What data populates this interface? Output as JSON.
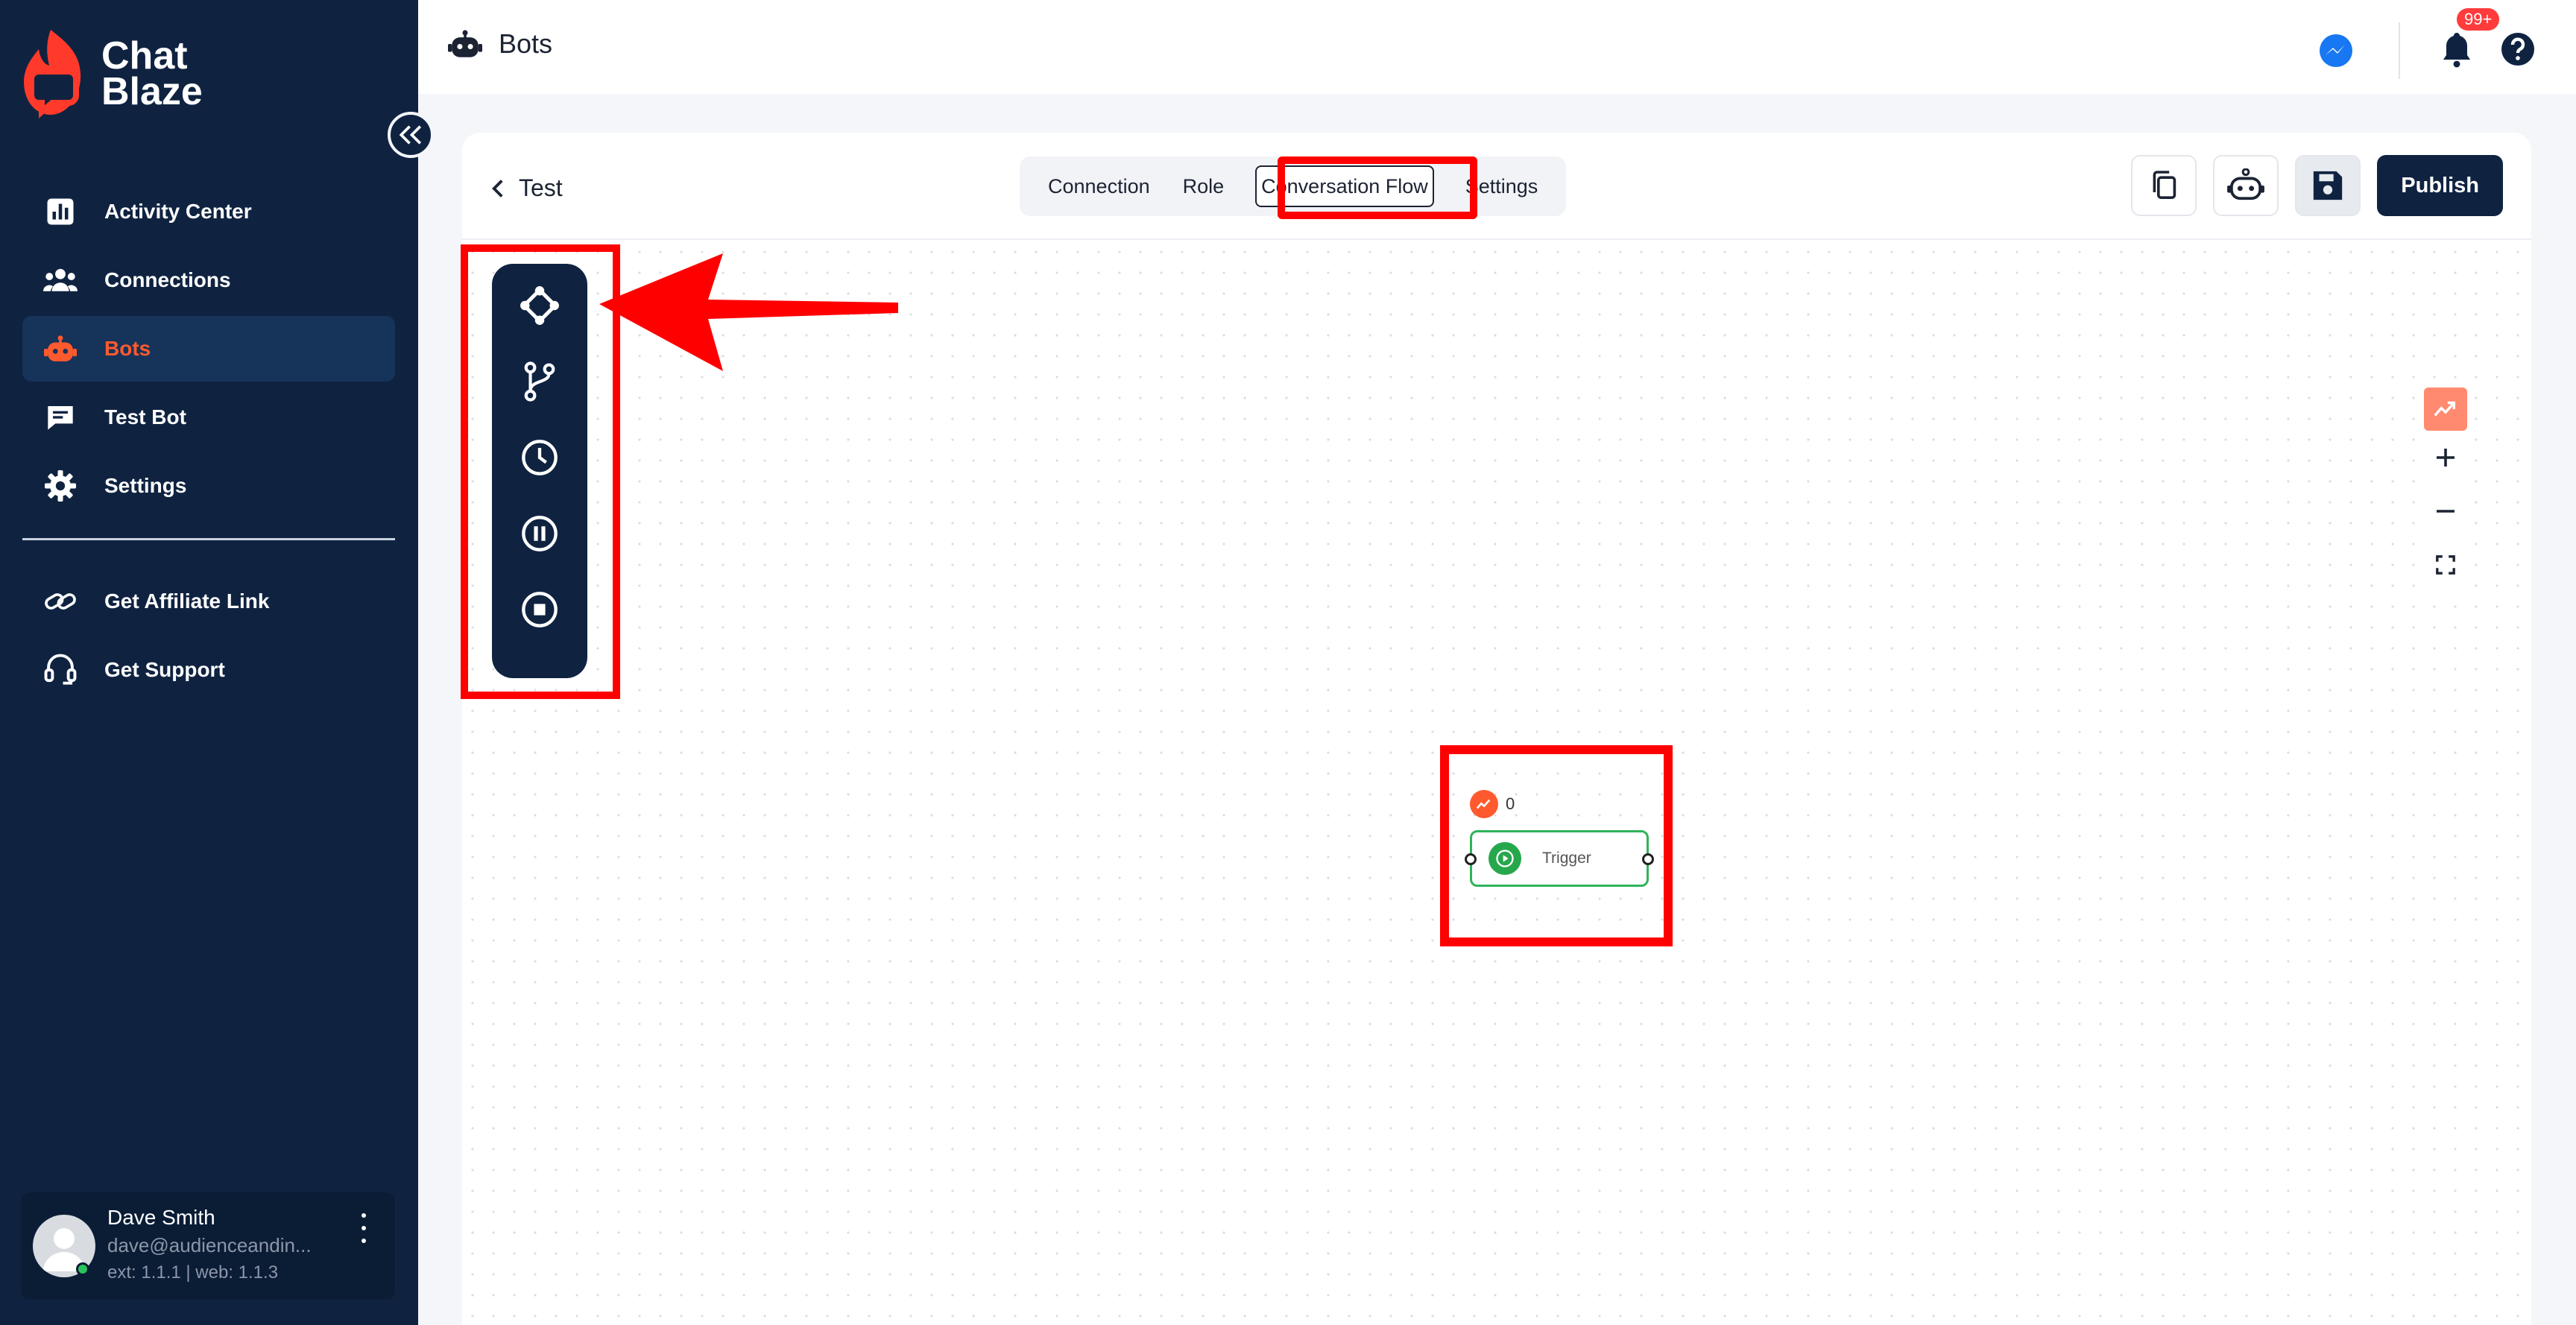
{
  "brand": {
    "line1": "Chat",
    "line2": "Blaze",
    "accent": "#ff5a2e",
    "sidebar_bg": "#0f2341"
  },
  "sidebar": {
    "items": [
      {
        "label": "Activity Center",
        "icon": "bar-chart-icon"
      },
      {
        "label": "Connections",
        "icon": "users-icon"
      },
      {
        "label": "Bots",
        "icon": "robot-icon",
        "active": true
      },
      {
        "label": "Test Bot",
        "icon": "chat-icon"
      },
      {
        "label": "Settings",
        "icon": "gear-icon"
      }
    ],
    "secondary": [
      {
        "label": "Get Affiliate Link",
        "icon": "link-icon"
      },
      {
        "label": "Get Support",
        "icon": "headset-icon"
      }
    ],
    "user": {
      "name": "Dave Smith",
      "email": "dave@audienceandin...",
      "versions": "ext: 1.1.1 | web: 1.1.3"
    }
  },
  "header": {
    "title": "Bots",
    "notification_badge": "99+"
  },
  "bot": {
    "back_label": "Test",
    "tabs": [
      "Connection",
      "Role",
      "Conversation Flow",
      "Settings"
    ],
    "active_tab": "Conversation Flow",
    "publish_label": "Publish"
  },
  "canvas": {
    "palette": [
      "hub-node-icon",
      "branch-icon",
      "clock-icon",
      "pause-icon",
      "stop-icon"
    ],
    "trigger_node": {
      "label": "Trigger",
      "count": "0"
    }
  }
}
